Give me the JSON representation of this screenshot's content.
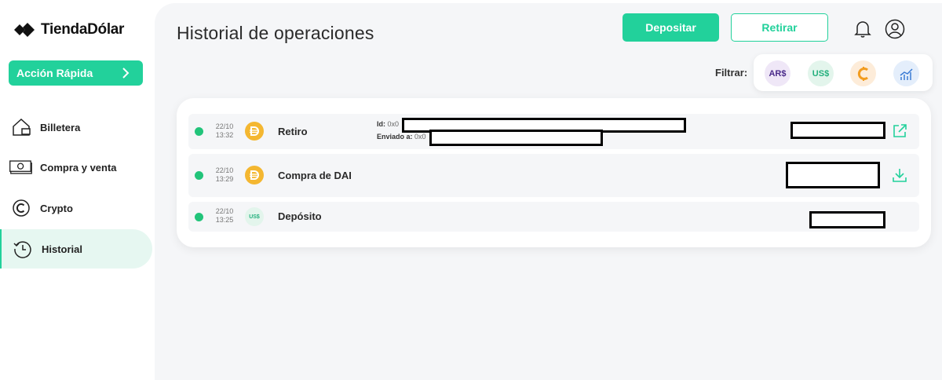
{
  "brand": {
    "name": "TiendaDólar"
  },
  "sidebar": {
    "quick_action": "Acción Rápida",
    "items": [
      {
        "label": "Billetera",
        "icon": "home-wallet-icon"
      },
      {
        "label": "Compra y venta",
        "icon": "banknote-icon"
      },
      {
        "label": "Crypto",
        "icon": "crypto-coin-icon"
      },
      {
        "label": "Historial",
        "icon": "history-icon",
        "active": true
      }
    ]
  },
  "header": {
    "title": "Historial de operaciones",
    "deposit_label": "Depositar",
    "withdraw_label": "Retirar"
  },
  "filter": {
    "label": "Filtrar:",
    "chips": [
      "AR$",
      "US$",
      "crypto-c-icon",
      "chart-icon"
    ]
  },
  "operations": [
    {
      "day": "22/10",
      "time": "13:32",
      "coin": "DAI",
      "label": "Retiro",
      "id_label": "Id:",
      "id_prefix": "0x0",
      "sent_label": "Enviado a:",
      "sent_prefix": "0x0",
      "action_icon": "external-link-icon"
    },
    {
      "day": "22/10",
      "time": "13:29",
      "coin": "DAI",
      "label": "Compra de DAI",
      "action_icon": "download-icon"
    },
    {
      "day": "22/10",
      "time": "13:25",
      "coin": "US$",
      "label": "Depósito"
    }
  ],
  "colors": {
    "accent": "#22d19b",
    "status_ok": "#22c47a",
    "dai": "#f4b731"
  }
}
